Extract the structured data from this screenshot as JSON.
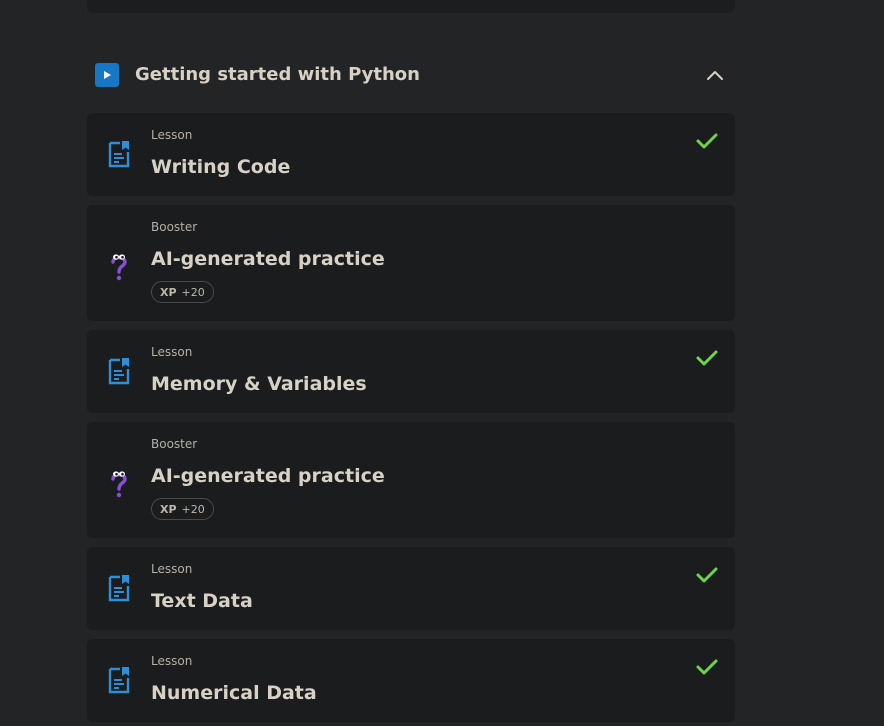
{
  "section": {
    "title": "Getting started with Python",
    "icon": "play-icon",
    "collapse_icon": "chevron-up-icon",
    "accent_color": "#1677c4"
  },
  "items": [
    {
      "kind": "Lesson",
      "title": "Writing Code",
      "icon": "lesson-document-icon",
      "completed": true
    },
    {
      "kind": "Booster",
      "title": "AI-generated practice",
      "icon": "question-mascot-icon",
      "xp_label": "XP",
      "xp_value": "+20"
    },
    {
      "kind": "Lesson",
      "title": "Memory & Variables",
      "icon": "lesson-document-icon",
      "completed": true
    },
    {
      "kind": "Booster",
      "title": "AI-generated practice",
      "icon": "question-mascot-icon",
      "xp_label": "XP",
      "xp_value": "+20"
    },
    {
      "kind": "Lesson",
      "title": "Text Data",
      "icon": "lesson-document-icon",
      "completed": true
    },
    {
      "kind": "Lesson",
      "title": "Numerical Data",
      "icon": "lesson-document-icon",
      "completed": true
    }
  ],
  "colors": {
    "background": "#232425",
    "card": "#1b1c1d",
    "check": "#6fd44a",
    "lesson_icon": "#2f8fd6",
    "booster_icon": "#8a4fd8"
  }
}
